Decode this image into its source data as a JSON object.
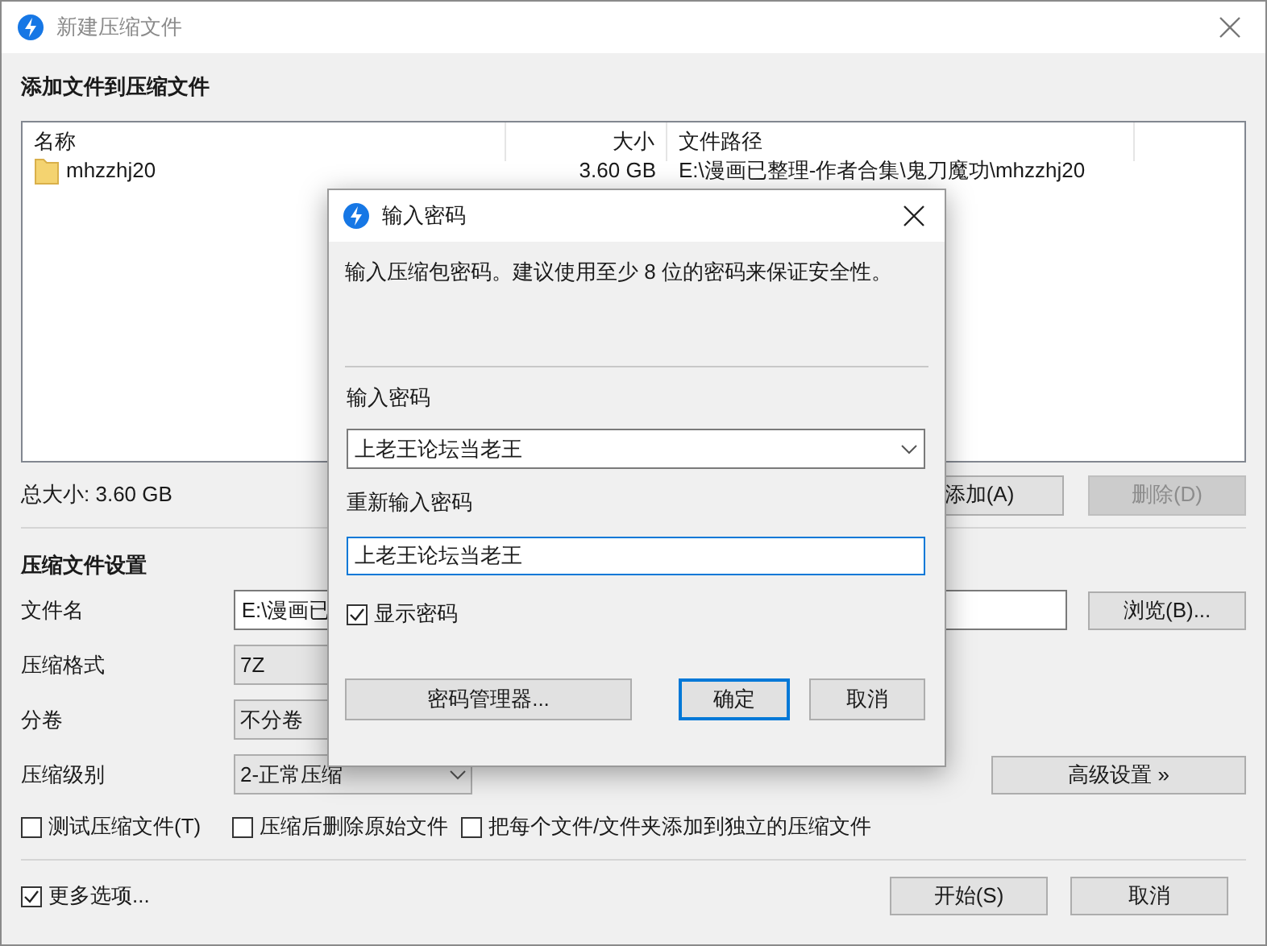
{
  "window": {
    "title": "新建压缩文件"
  },
  "files_section": {
    "heading": "添加文件到压缩文件",
    "columns": [
      "名称",
      "大小",
      "文件路径"
    ],
    "rows": [
      {
        "name": "mhzzhj20",
        "size": "3.60 GB",
        "path": "E:\\漫画已整理-作者合集\\鬼刀魔功\\mhzzhj20"
      }
    ],
    "total": "总大小: 3.60 GB",
    "buttons": [
      {
        "label": "添加(A)",
        "disabled": false
      },
      {
        "label": "删除(D)",
        "disabled": true
      }
    ]
  },
  "settings": {
    "heading": "压缩文件设置",
    "fields": [
      {
        "kind": "text",
        "label": "文件名",
        "value": "E:\\漫画已"
      },
      {
        "kind": "select",
        "label": "压缩格式",
        "value": "7Z"
      },
      {
        "kind": "select",
        "label": "分卷",
        "value": "不分卷"
      },
      {
        "kind": "select",
        "label": "压缩级别",
        "value": "2-正常压缩"
      }
    ],
    "browse_button": "浏览(B)...",
    "advanced_button": "高级设置 »",
    "options": [
      {
        "label": "测试压缩文件(T)",
        "checked": false
      },
      {
        "label": "压缩后删除原始文件",
        "checked": false
      },
      {
        "label": "把每个文件/文件夹添加到独立的压缩文件",
        "checked": false
      }
    ]
  },
  "footer": {
    "more_options": {
      "label": "更多选项...",
      "checked": true
    },
    "buttons": [
      "开始(S)",
      "取消"
    ]
  },
  "dialog": {
    "title": "输入密码",
    "message": "输入压缩包密码。建议使用至少 8 位的密码来保证安全性。",
    "password_label": "输入密码",
    "password": "上老王论坛当老王",
    "confirm_label": "重新输入密码",
    "confirm": "上老王论坛当老王",
    "show_password": {
      "label": "显示密码",
      "checked": true
    },
    "buttons": [
      {
        "label": "密码管理器...",
        "default": false
      },
      {
        "label": "确定",
        "default": true
      },
      {
        "label": "取消",
        "default": false
      }
    ]
  }
}
